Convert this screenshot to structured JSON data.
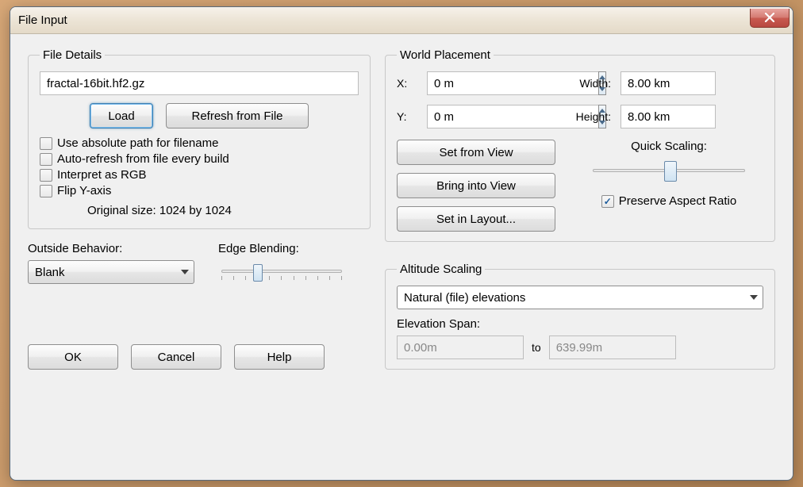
{
  "window": {
    "title": "File Input"
  },
  "fileDetails": {
    "legend": "File Details",
    "filename": "fractal-16bit.hf2.gz",
    "loadLabel": "Load",
    "refreshLabel": "Refresh from File",
    "chkAbsPath": "Use absolute path for filename",
    "chkAutoRefresh": "Auto-refresh from file every build",
    "chkRGB": "Interpret as RGB",
    "chkFlipY": "Flip Y-axis",
    "originalSize": "Original size: 1024 by 1024"
  },
  "outside": {
    "behaviorLabel": "Outside Behavior:",
    "behaviorValue": "Blank",
    "edgeLabel": "Edge Blending:"
  },
  "dialogButtons": {
    "ok": "OK",
    "cancel": "Cancel",
    "help": "Help"
  },
  "worldPlacement": {
    "legend": "World Placement",
    "xLabel": "X:",
    "xValue": "0 m",
    "yLabel": "Y:",
    "yValue": "0 m",
    "widthLabel": "Width:",
    "widthValue": "8.00 km",
    "heightLabel": "Height:",
    "heightValue": "8.00 km",
    "setFromView": "Set from View",
    "bringIntoView": "Bring into View",
    "setInLayout": "Set in Layout...",
    "quickScalingLabel": "Quick Scaling:",
    "preserveAspect": "Preserve Aspect Ratio"
  },
  "altitude": {
    "legend": "Altitude Scaling",
    "mode": "Natural (file) elevations",
    "spanLabel": "Elevation Span:",
    "spanMin": "0.00m",
    "toLabel": "to",
    "spanMax": "639.99m"
  }
}
